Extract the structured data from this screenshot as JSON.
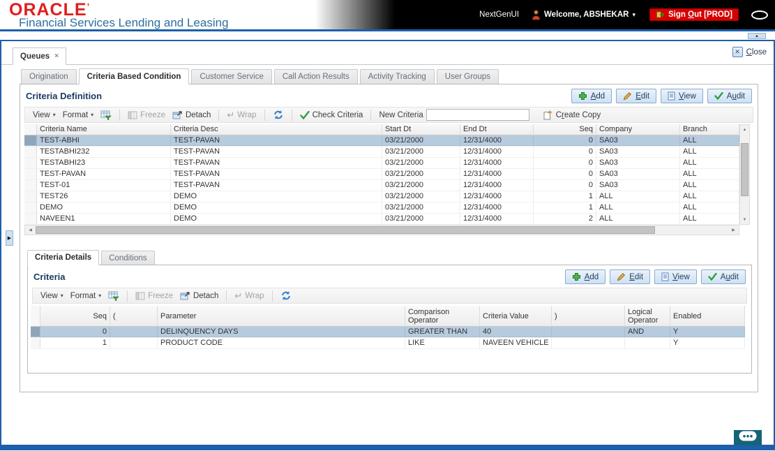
{
  "header": {
    "logo_text": "ORACLE",
    "logo_mark": "’",
    "subtitle": "Financial Services Lending and Leasing",
    "nextgen_label": "NextGenUI",
    "welcome_label": "Welcome, ABSHEKAR",
    "sign_out_label": "Sign Out [PROD]"
  },
  "window": {
    "workspace_tab": "Queues",
    "workspace_tab_close": "×",
    "close_label": "Close"
  },
  "module_tabs": [
    {
      "label": "Origination",
      "active": false
    },
    {
      "label": "Criteria Based Condition",
      "active": true
    },
    {
      "label": "Customer Service",
      "active": false
    },
    {
      "label": "Call Action Results",
      "active": false
    },
    {
      "label": "Activity Tracking",
      "active": false
    },
    {
      "label": "User Groups",
      "active": false
    }
  ],
  "criteria_definition": {
    "title": "Criteria Definition",
    "actions": [
      {
        "name": "add",
        "label": "Add",
        "underline": 0,
        "icon": "add-plus-icon"
      },
      {
        "name": "edit",
        "label": "Edit",
        "underline": 0,
        "icon": "edit-pencil-icon"
      },
      {
        "name": "view",
        "label": "View",
        "underline": 0,
        "icon": "view-document-icon"
      },
      {
        "name": "audit",
        "label": "Audit",
        "underline": 1,
        "icon": "audit-check-icon"
      }
    ],
    "toolbar": {
      "view_label": "View",
      "format_label": "Format",
      "freeze_label": "Freeze",
      "detach_label": "Detach",
      "wrap_label": "Wrap",
      "check_criteria_label": "Check Criteria",
      "new_criteria_label": "New Criteria",
      "new_criteria_value": "",
      "create_copy_label": "Create Copy"
    },
    "columns": [
      "Criteria Name",
      "Criteria Desc",
      "Start Dt",
      "End Dt",
      "Seq",
      "Company",
      "Branch"
    ],
    "rows": [
      [
        "TEST-ABHI",
        "TEST-PAVAN",
        "03/21/2000",
        "12/31/4000",
        "0",
        "SA03",
        "ALL"
      ],
      [
        "TESTABHI232",
        "TEST-PAVAN",
        "03/21/2000",
        "12/31/4000",
        "0",
        "SA03",
        "ALL"
      ],
      [
        "TESTABHI23",
        "TEST-PAVAN",
        "03/21/2000",
        "12/31/4000",
        "0",
        "SA03",
        "ALL"
      ],
      [
        "TEST-PAVAN",
        "TEST-PAVAN",
        "03/21/2000",
        "12/31/4000",
        "0",
        "SA03",
        "ALL"
      ],
      [
        "TEST-01",
        "TEST-PAVAN",
        "03/21/2000",
        "12/31/4000",
        "0",
        "SA03",
        "ALL"
      ],
      [
        "TEST26",
        "DEMO",
        "03/21/2000",
        "12/31/4000",
        "1",
        "ALL",
        "ALL"
      ],
      [
        "DEMO",
        "DEMO",
        "03/21/2000",
        "12/31/4000",
        "1",
        "ALL",
        "ALL"
      ],
      [
        "NAVEEN1",
        "DEMO",
        "03/21/2000",
        "12/31/4000",
        "2",
        "ALL",
        "ALL"
      ]
    ],
    "selected_row_index": 0
  },
  "detail_tabs": [
    {
      "label": "Criteria Details",
      "active": true
    },
    {
      "label": "Conditions",
      "active": false
    }
  ],
  "criteria_details": {
    "title": "Criteria",
    "actions": [
      {
        "name": "add",
        "label": "Add",
        "underline": 0,
        "icon": "add-plus-icon"
      },
      {
        "name": "edit",
        "label": "Edit",
        "underline": 0,
        "icon": "edit-pencil-icon"
      },
      {
        "name": "view",
        "label": "View",
        "underline": 0,
        "icon": "view-document-icon"
      },
      {
        "name": "audit",
        "label": "Audit",
        "underline": 1,
        "icon": "audit-check-icon"
      }
    ],
    "toolbar": {
      "view_label": "View",
      "format_label": "Format",
      "freeze_label": "Freeze",
      "detach_label": "Detach",
      "wrap_label": "Wrap"
    },
    "columns": [
      "Seq",
      "(",
      "Parameter",
      "Comparison Operator",
      "Criteria Value",
      ")",
      "Logical Operator",
      "Enabled"
    ],
    "rows": [
      [
        "0",
        "",
        "DELINQUENCY DAYS",
        "GREATER THAN",
        "40",
        "",
        "AND",
        "Y"
      ],
      [
        "1",
        "",
        "PRODUCT CODE",
        "LIKE",
        "NAVEEN VEHICLE",
        "",
        "",
        "Y"
      ]
    ],
    "selected_row_index": 0
  },
  "colors": {
    "oracle_red": "#e21d1d",
    "brand_blue": "#2e6e9e",
    "frame_blue": "#1e5fa9",
    "selected_row": "#b7cbdf",
    "chat_teal": "#156378"
  }
}
